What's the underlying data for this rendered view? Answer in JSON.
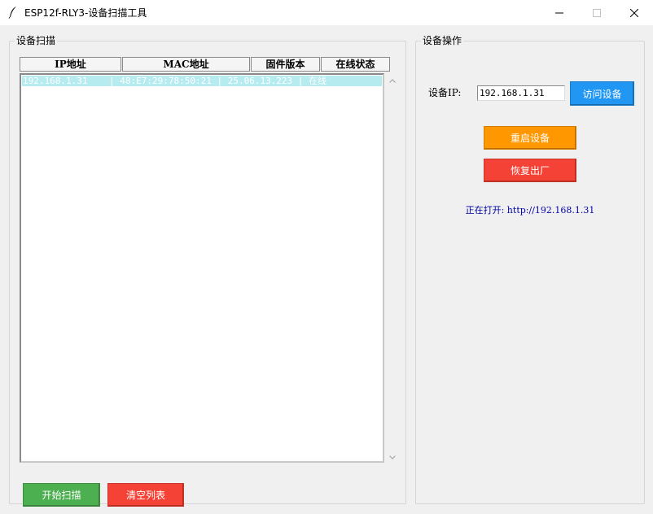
{
  "window": {
    "title": "ESP12f-RLY3-设备扫描工具",
    "icon": "feather-icon",
    "controls": [
      "minimize-icon",
      "maximize-icon",
      "close-icon"
    ]
  },
  "scan_group": {
    "label": "设备扫描",
    "columns": [
      "IP地址",
      "MAC地址",
      "固件版本",
      "在线状态"
    ],
    "rows": [
      {
        "ip": "192.168.1.31",
        "mac": "48:E7:29:78:50:21",
        "firmware": "25.06.13.223",
        "status": "在线"
      }
    ],
    "buttons": {
      "start": "开始扫描",
      "clear": "清空列表"
    }
  },
  "ops_group": {
    "label": "设备操作",
    "ip_label": "设备IP:",
    "ip_value": "192.168.1.31",
    "buttons": {
      "visit": "访问设备",
      "reboot": "重启设备",
      "reset": "恢复出厂"
    },
    "status": "正在打开: http://192.168.1.31"
  },
  "colors": {
    "start_button": "#4caf50",
    "clear_button": "#f44336",
    "visit_button": "#2196f3",
    "reboot_button": "#ff9800",
    "reset_button": "#f44336",
    "selected_row": "#b6ebf0",
    "status_text": "#0000aa"
  }
}
